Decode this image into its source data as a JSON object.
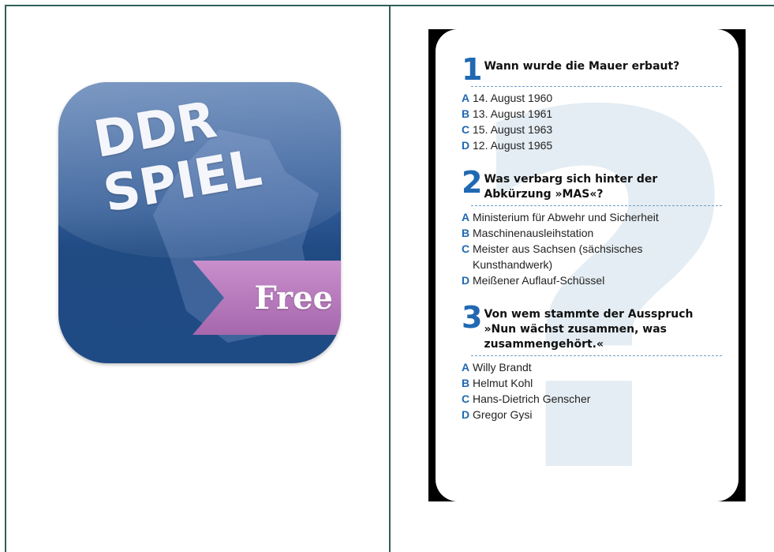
{
  "app_icon": {
    "title_line1": "DDR",
    "title_line2": "SPIEL",
    "ribbon_label": "Free"
  },
  "quiz": {
    "questions": [
      {
        "number": "1",
        "text": "Wann wurde die Mauer erbaut?",
        "answers": [
          {
            "letter": "A",
            "text": "14. August 1960"
          },
          {
            "letter": "B",
            "text": "13. August 1961"
          },
          {
            "letter": "C",
            "text": "15. August 1963"
          },
          {
            "letter": "D",
            "text": "12. August 1965"
          }
        ]
      },
      {
        "number": "2",
        "text": "Was verbarg sich hinter der Abkürzung »MAS«?",
        "answers": [
          {
            "letter": "A",
            "text": "Ministerium für Abwehr und Sicherheit"
          },
          {
            "letter": "B",
            "text": "Maschinenausleihstation"
          },
          {
            "letter": "C",
            "text": "Meister aus Sachsen (sächsisches Kunsthandwerk)"
          },
          {
            "letter": "D",
            "text": "Meißener Auflauf-Schüssel"
          }
        ]
      },
      {
        "number": "3",
        "text": "Von wem stammte der Ausspruch »Nun wächst zusammen, was zusammengehört.«",
        "answers": [
          {
            "letter": "A",
            "text": "Willy Brandt"
          },
          {
            "letter": "B",
            "text": "Helmut Kohl"
          },
          {
            "letter": "C",
            "text": "Hans-Dietrich Genscher"
          },
          {
            "letter": "D",
            "text": "Gregor Gysi"
          }
        ]
      }
    ]
  }
}
